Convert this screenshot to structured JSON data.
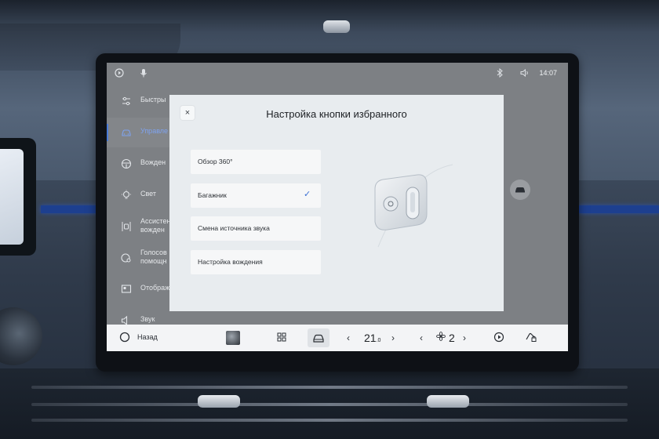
{
  "status": {
    "time": "14:07",
    "icons": [
      "play-circle-icon",
      "microphone-icon",
      "bluetooth-icon",
      "volume-icon"
    ]
  },
  "sidebar": {
    "items": [
      {
        "label": "Быстры",
        "icon": "sliders-icon"
      },
      {
        "label": "Управле",
        "icon": "car-icon",
        "active": true
      },
      {
        "label": "Вожден",
        "icon": "steering-wheel-icon"
      },
      {
        "label": "Свет",
        "icon": "light-bulb-icon"
      },
      {
        "label": "Ассистен вожден",
        "icon": "lane-assist-icon"
      },
      {
        "label": "Голосов помощн",
        "icon": "voice-assistant-icon"
      },
      {
        "label": "Отображ",
        "icon": "display-icon"
      },
      {
        "label": "Звук",
        "icon": "speaker-icon"
      }
    ]
  },
  "modal": {
    "close": "×",
    "title": "Настройка кнопки избранного",
    "options": [
      {
        "label": "Обзор 360°",
        "selected": false
      },
      {
        "label": "Багажник",
        "selected": true
      },
      {
        "label": "Смена источника звука",
        "selected": false
      },
      {
        "label": "Настройка вождения",
        "selected": false
      }
    ],
    "check": "✓"
  },
  "dock": {
    "back_label": "Назад",
    "temp_main": "21",
    "temp_decimal": ".0",
    "fan_level": "2",
    "left_arrow": "‹",
    "right_arrow": "›"
  },
  "colors": {
    "accent": "#3b6fd4",
    "active_text": "#7ea2ee",
    "modal_bg": "#e8ecef"
  }
}
